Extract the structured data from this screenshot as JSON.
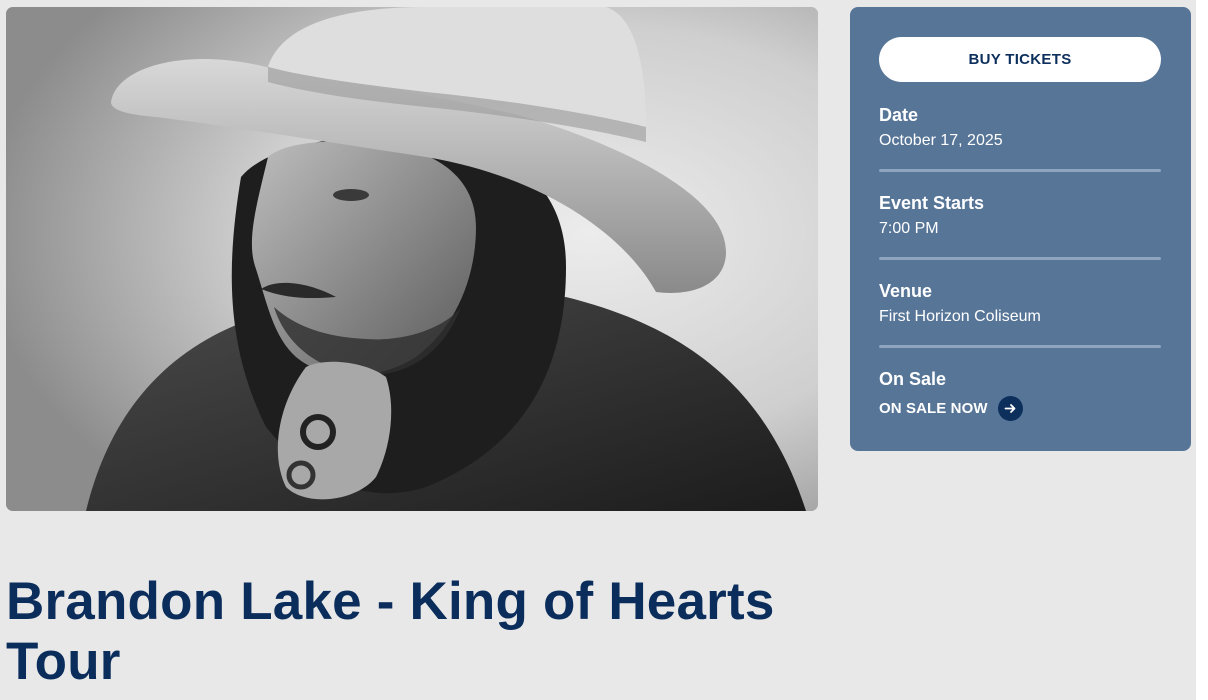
{
  "hero": {
    "image_subject": "artist-portrait"
  },
  "tickets": {
    "buy_label": "BUY TICKETS"
  },
  "details": {
    "date_label": "Date",
    "date_value": "October 17, 2025",
    "start_label": "Event Starts",
    "start_value": "7:00 PM",
    "venue_label": "Venue",
    "venue_value": "First Horizon Coliseum",
    "onsale_label": "On Sale",
    "onsale_value": "ON SALE NOW",
    "onsale_icon": "arrow-right-icon"
  },
  "event": {
    "title": "Brandon Lake - King of Hearts Tour"
  },
  "colors": {
    "page_bg": "#e8e8e9",
    "card_bg": "#577597",
    "brand_navy": "#0b2d5b",
    "divider": "#8fa4be"
  }
}
